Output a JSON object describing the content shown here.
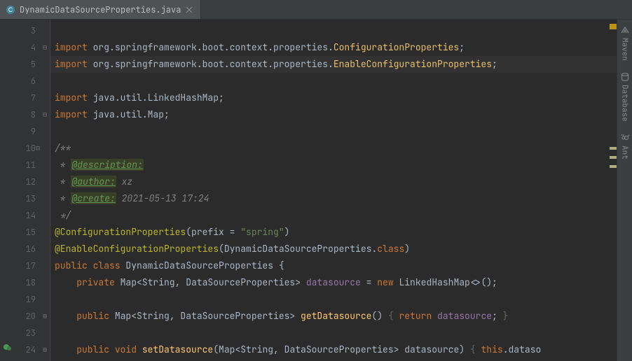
{
  "tab": {
    "filename": "DynamicDataSourceProperties.java"
  },
  "gutter": {
    "start": 3,
    "end": 24
  },
  "code": {
    "l3": "",
    "l4_kw": "import",
    "l4_pkg": " org.springframework.boot.context.properties.",
    "l4_cls": "ConfigurationProperties",
    "l4_semi": ";",
    "l5_kw": "import",
    "l5_pkg": " org.springframework.boot.context.properties.",
    "l5_cls": "EnableConfigurationProperties",
    "l5_semi": ";",
    "l6": "",
    "l7_kw": "import",
    "l7_pkg": " java.util.LinkedHashMap",
    "l7_semi": ";",
    "l8_kw": "import",
    "l8_pkg": " java.util.Map",
    "l8_semi": ";",
    "l9": "",
    "l10": "/**",
    "l11_pre": " * ",
    "l11_tag": "@description:",
    "l12_pre": " * ",
    "l12_tag": "@author:",
    "l12_txt": " xz",
    "l13_pre": " * ",
    "l13_tag": "@create:",
    "l13_txt": " 2021-05-13 17:24",
    "l14": " */",
    "l15_anno": "@ConfigurationProperties",
    "l15_paren_o": "(",
    "l15_param": "prefix",
    "l15_eq": " = ",
    "l15_str": "\"spring\"",
    "l15_paren_c": ")",
    "l16_anno": "@EnableConfigurationProperties",
    "l16_paren_o": "(",
    "l16_cls": "DynamicDataSourceProperties",
    "l16_dot": ".",
    "l16_kw": "class",
    "l16_paren_c": ")",
    "l17_kw1": "public",
    "l17_kw2": " class ",
    "l17_cls": "DynamicDataSourceProperties",
    "l17_brace": " {",
    "l18_ind": "    ",
    "l18_kw": "private ",
    "l18_type": "Map<String, DataSourceProperties> ",
    "l18_field": "datasource",
    "l18_eq": " = ",
    "l18_new": "new ",
    "l18_ctor": "LinkedHashMap<>()",
    "l18_semi": ";",
    "l19": "",
    "l20_ind": "    ",
    "l20_kw": "public ",
    "l20_type": "Map<String, DataSourceProperties> ",
    "l20_method": "getDatasource",
    "l20_p": "() ",
    "l20_bo": "{ ",
    "l20_ret": "return ",
    "l20_field": "datasource",
    "l20_semi": ";",
    "l20_bc": " }",
    "l23": "",
    "l24_ind": "    ",
    "l24_kw1": "public ",
    "l24_kw2": "void ",
    "l24_method": "setDatasource",
    "l24_po": "(",
    "l24_ptype": "Map<String, DataSourceProperties> ",
    "l24_pname": "datasource",
    "l24_pc": ") ",
    "l24_bo": "{ ",
    "l24_this": "this",
    "l24_dot": ".",
    "l24_tail": "dataso"
  },
  "sidebar": {
    "maven": "Maven",
    "database": "Database",
    "ant": "Ant"
  }
}
